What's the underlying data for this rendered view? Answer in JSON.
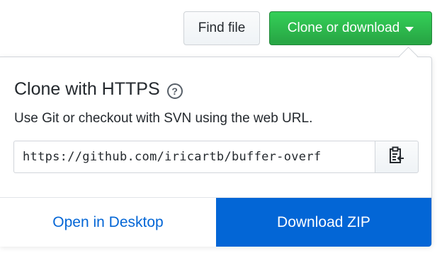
{
  "toolbar": {
    "find_file_label": "Find file",
    "clone_label": "Clone or download"
  },
  "clone_panel": {
    "title": "Clone with HTTPS",
    "help_icon": "question-circle-icon",
    "help_glyph": "?",
    "description": "Use Git or checkout with SVN using the web URL.",
    "url_value": "https://github.com/iricartb/buffer-overf",
    "copy_icon": "clipboard-icon",
    "open_desktop_label": "Open in Desktop",
    "download_zip_label": "Download ZIP"
  },
  "colors": {
    "clone_button_green": "#28a745",
    "download_blue": "#0366d6",
    "link_blue": "#0366d6"
  }
}
